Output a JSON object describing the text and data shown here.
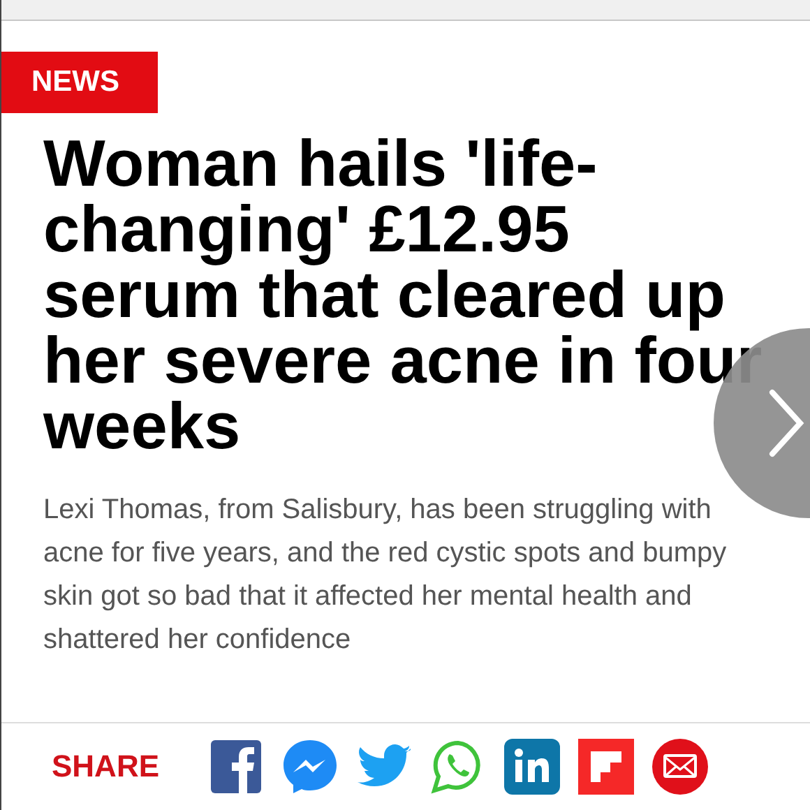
{
  "section_badge": "NEWS",
  "headline": "Woman hails 'life-changing' £12.95 serum that cleared up her severe acne in four weeks",
  "summary": "Lexi Thomas, from Salisbury, has been struggling with acne for five years, and the red cystic spots and bumpy skin got so bad that it affected her mental health and shattered her confidence",
  "share": {
    "label": "SHARE",
    "buttons": [
      {
        "kind": "facebook"
      },
      {
        "kind": "messenger"
      },
      {
        "kind": "twitter"
      },
      {
        "kind": "whatsapp"
      },
      {
        "kind": "linkedin"
      },
      {
        "kind": "flipboard"
      },
      {
        "kind": "email"
      }
    ]
  }
}
